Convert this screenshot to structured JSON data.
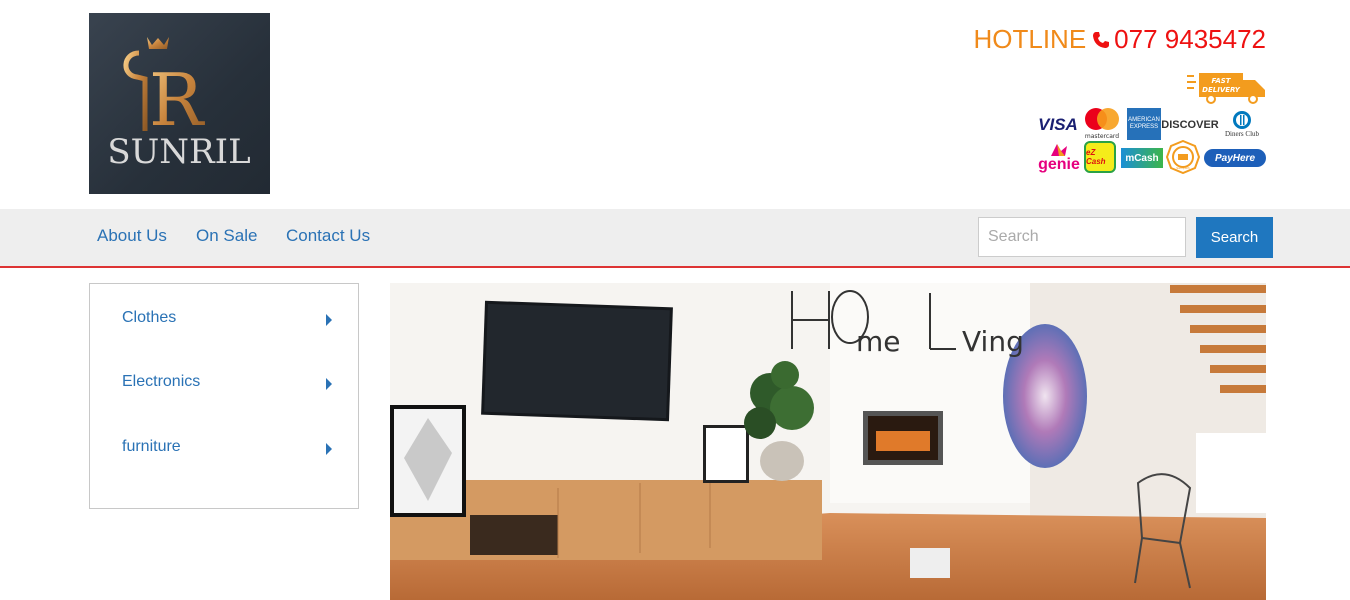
{
  "brand": {
    "logo_text": "SUNRIL",
    "logo_monogram": "R"
  },
  "header": {
    "hotline_label": "HOTLINE",
    "phone": "077 9435472",
    "phone_icon": "phone-icon",
    "delivery_badge": "FAST DELIVERY",
    "payment_methods": [
      "VISA",
      "mastercard",
      "AMERICAN EXPRESS",
      "DISCOVER",
      "Diners Club",
      "genie",
      "eZ Cash",
      "mCash",
      "Sampath",
      "PayHere"
    ]
  },
  "nav": {
    "links": [
      "About Us",
      "On Sale",
      "Contact Us"
    ],
    "search_placeholder": "Search",
    "search_button": "Search"
  },
  "categories": [
    "Clothes",
    "Electronics",
    "furniture"
  ],
  "banner": {
    "title_part1": "HO",
    "title_part2": "me",
    "title_part3": "Li",
    "title_part4": "Ving"
  },
  "colors": {
    "accent": "#1f77bf",
    "link": "#2a72b5",
    "hotline": "#e11111",
    "hotline_label": "#f08a1a",
    "nav_border": "#dd3333"
  }
}
